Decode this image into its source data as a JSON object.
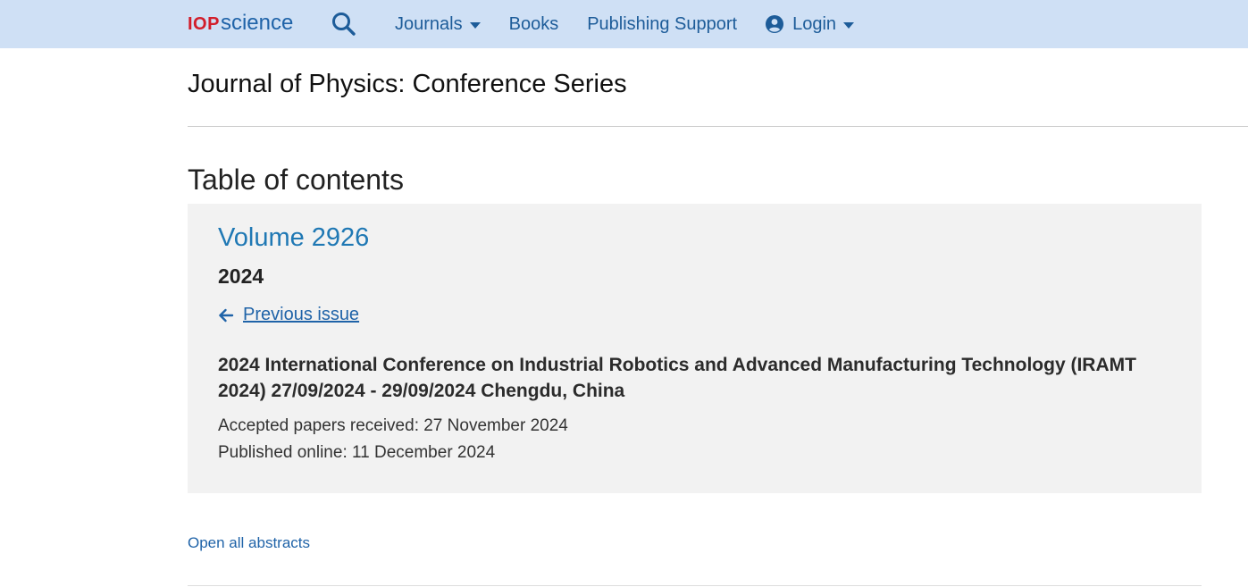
{
  "header": {
    "logo_iop": "IOP",
    "logo_science": "science",
    "nav": {
      "journals_label": "Journals",
      "books_label": "Books",
      "support_label": "Publishing Support",
      "login_label": "Login"
    },
    "icons": {
      "search": "search-icon",
      "user": "user-circle-icon",
      "caret": "caret-down-icon"
    }
  },
  "journal": {
    "title": "Journal of Physics: Conference Series"
  },
  "toc": {
    "heading": "Table of contents"
  },
  "volume": {
    "title": "Volume 2926",
    "year": "2024",
    "previous_issue_label": "Previous issue",
    "conference_title": "2024 International Conference on Industrial Robotics and Advanced Manufacturing Technology (IRAMT 2024) 27/09/2024 - 29/09/2024 Chengdu, China",
    "accepted": "Accepted papers received: 27 November 2024",
    "published": "Published online: 11 December 2024"
  },
  "actions": {
    "open_all_abstracts": "Open all abstracts"
  },
  "colors": {
    "topbar_bg": "#cfe0f5",
    "logo_red": "#d21e2b",
    "link_blue": "#1f63a8",
    "volume_blue": "#1f78b4",
    "panel_bg": "#f2f2f2"
  }
}
